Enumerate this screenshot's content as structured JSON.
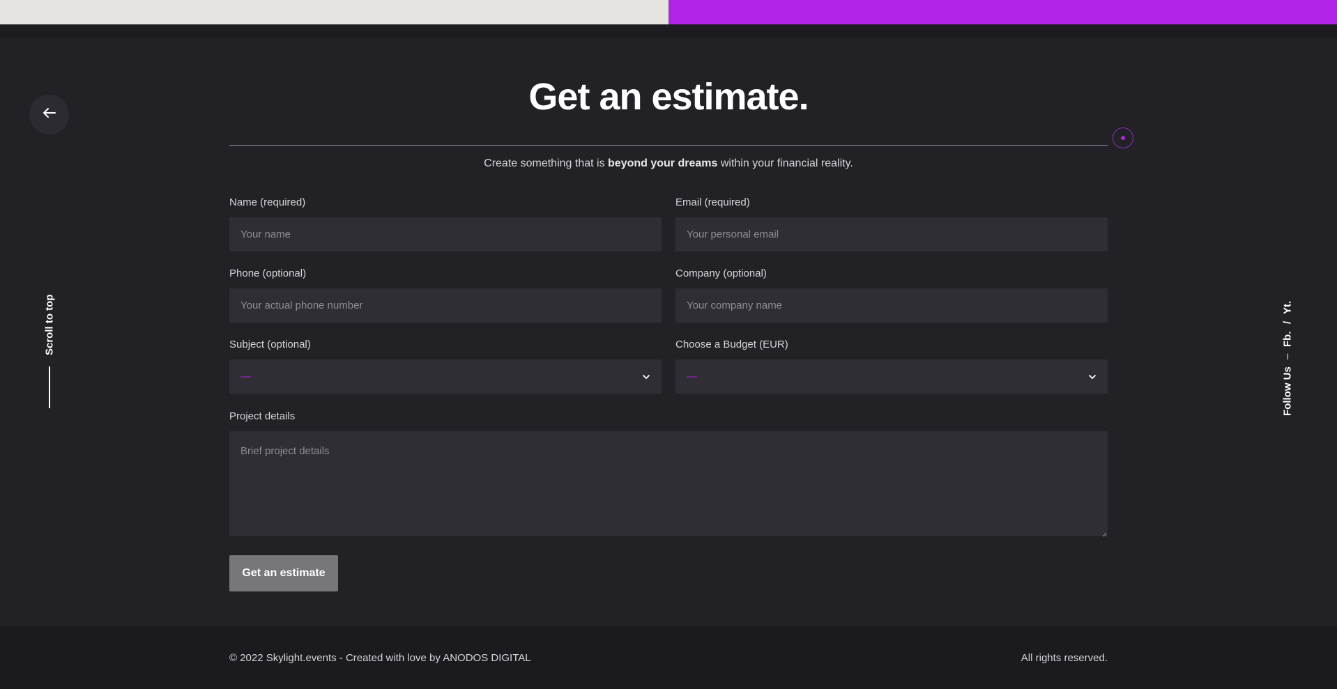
{
  "colors": {
    "accent": "#b123e6",
    "background": "#222126",
    "field": "#2f2e34",
    "button": "#77767a"
  },
  "nav": {
    "back_icon": "arrow-left-icon",
    "scroll_to_top": "Scroll to top"
  },
  "social": {
    "label": "Follow Us",
    "separator": "–",
    "links": [
      "Fb.",
      "/",
      "Yt."
    ]
  },
  "header": {
    "title": "Get an estimate.",
    "subtitle_pre": "Create something that is ",
    "subtitle_bold": "beyond your dreams",
    "subtitle_post": " within your financial reality."
  },
  "form": {
    "name": {
      "label": "Name (required)",
      "placeholder": "Your name"
    },
    "email": {
      "label": "Email (required)",
      "placeholder": "Your personal email"
    },
    "phone": {
      "label": "Phone (optional)",
      "placeholder": "Your actual phone number"
    },
    "company": {
      "label": "Company (optional)",
      "placeholder": "Your company name"
    },
    "subject": {
      "label": "Subject (optional)",
      "value": "—"
    },
    "budget": {
      "label": "Choose a Budget (EUR)",
      "value": "—"
    },
    "details": {
      "label": "Project details",
      "placeholder": "Brief project details"
    },
    "submit_label": "Get an estimate"
  },
  "footer": {
    "copyright": "© 2022 Skylight.events - Created with love by ANODOS DIGITAL",
    "rights": "All rights reserved."
  }
}
